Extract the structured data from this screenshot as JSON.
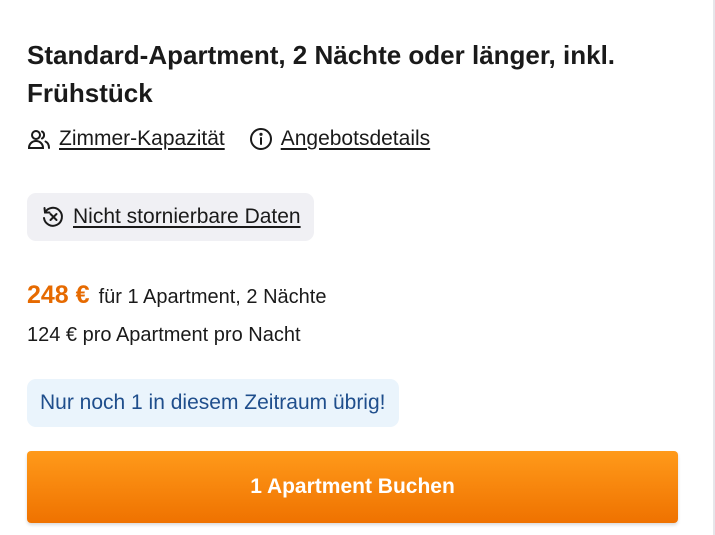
{
  "room": {
    "title": "Standard-Apartment, 2 Nächte oder länger, inkl. Frühstück"
  },
  "links": {
    "capacity": "Zimmer-Kapazität",
    "offer_details": "Angebotsdetails"
  },
  "cancellation": {
    "label": "Nicht stornierbare Daten"
  },
  "pricing": {
    "total": "248 €",
    "total_desc": "für 1 Apartment, 2 Nächte",
    "per_night": "124 € pro Apartment pro Nacht"
  },
  "availability": {
    "message": "Nur noch 1 in diesem Zeitraum übrig!"
  },
  "booking": {
    "button_label": "1 Apartment Buchen"
  },
  "colors": {
    "price": "#e66a00",
    "book_button": "#f58300",
    "availability_text": "#1f4e8c",
    "availability_bg": "#eaf4fc",
    "chip_bg": "#f0f0f4"
  },
  "icons": {
    "capacity": "people-icon",
    "offer_details": "info-icon",
    "cancellation": "no-refund-icon"
  }
}
